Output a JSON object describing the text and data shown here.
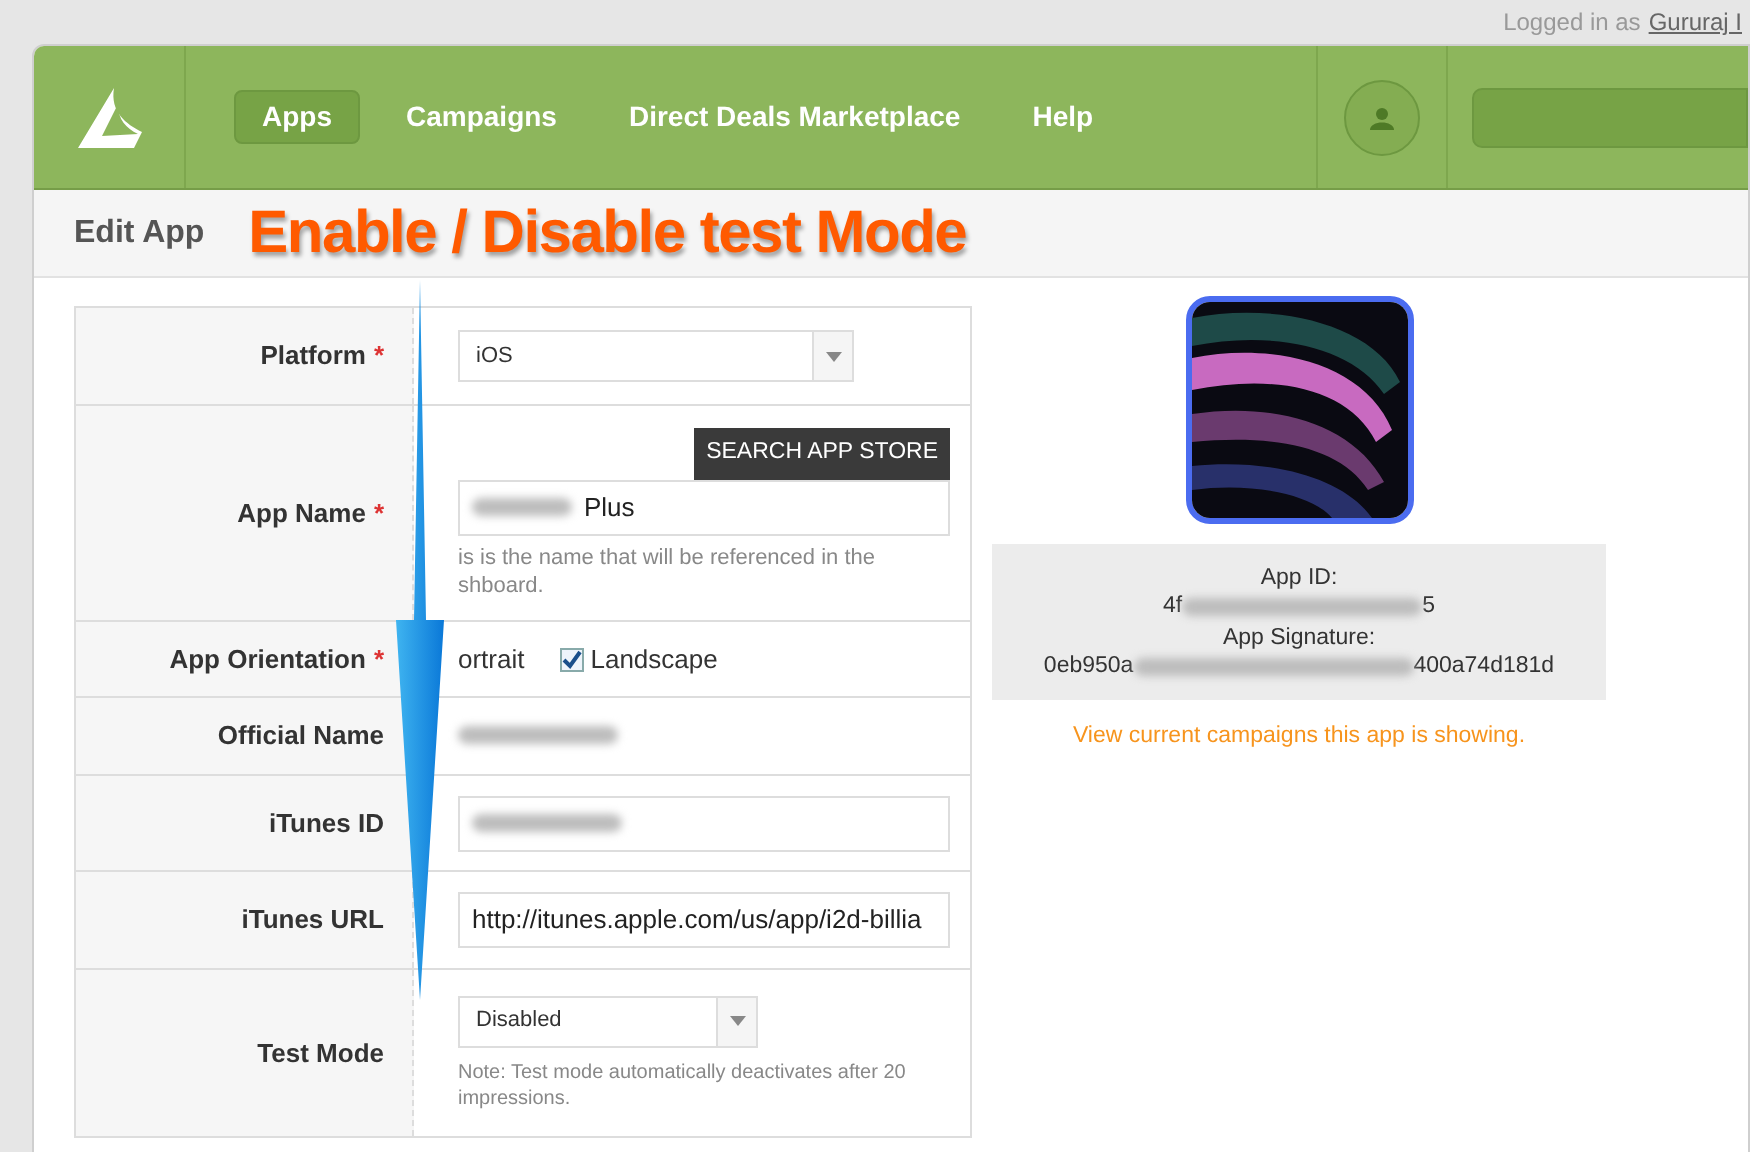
{
  "top_bar": {
    "logged_in": "Logged in as",
    "user": "Gururaj I"
  },
  "nav": {
    "items": [
      {
        "label": "Apps",
        "selected": true
      },
      {
        "label": "Campaigns",
        "selected": false
      },
      {
        "label": "Direct Deals Marketplace",
        "selected": false
      },
      {
        "label": "Help",
        "selected": false
      }
    ]
  },
  "header": {
    "title": "Edit App",
    "annotation": "Enable / Disable test Mode"
  },
  "form": {
    "rows": [
      {
        "kind": "select",
        "label": "Platform",
        "required_mark": "*",
        "value": "iOS"
      },
      {
        "kind": "input",
        "label": "App Name",
        "required_mark": "*",
        "button": "SEARCH APP STORE",
        "value": "Plus",
        "redacted": true,
        "help": [
          "is is the name that will be referenced in the",
          "shboard."
        ]
      },
      {
        "kind": "checkboxes",
        "label": "App Orientation",
        "required_mark": "*",
        "options": [
          {
            "label": "ortrait"
          },
          {
            "label": "Landscape",
            "checked": true
          }
        ]
      },
      {
        "kind": "text",
        "label": "Official Name",
        "redacted": true
      },
      {
        "kind": "input",
        "label": "iTunes ID",
        "redacted": true
      },
      {
        "kind": "input",
        "label": "iTunes URL",
        "value": "http://itunes.apple.com/us/app/i2d-billia"
      },
      {
        "kind": "select",
        "label": "Test Mode",
        "value": "Disabled",
        "help": [
          "Note: Test mode automatically deactivates after 20 impressions."
        ]
      }
    ]
  },
  "app_info": {
    "kind": "picture",
    "id_label": "App ID:",
    "id_start": "4f",
    "id_end": "5",
    "signature_label": "App Signature:",
    "signature_start": "0eb950a",
    "signature_end": "400a74d181d",
    "link": "View current campaigns this app is showing."
  }
}
